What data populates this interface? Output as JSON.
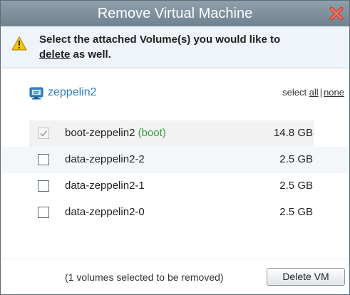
{
  "dialog": {
    "title": "Remove Virtual Machine",
    "close_icon": "close-x-icon",
    "warning_icon": "warning-icon",
    "prompt_line1": "Select the attached Volume(s) you would like to",
    "prompt_line2_underlined": "delete",
    "prompt_line2_rest": " as well."
  },
  "vm": {
    "name": "zeppelin2",
    "icon": "vm-icon"
  },
  "select_links": {
    "prefix": "select ",
    "all": "all",
    "separator": "|",
    "none": "none"
  },
  "background_faint_text": "",
  "volumes": [
    {
      "name": "boot-zeppelin2",
      "tag": "(boot)",
      "size": "14.8 GB",
      "checked": true,
      "disabled": true
    },
    {
      "name": "data-zeppelin2-2",
      "tag": "",
      "size": "2.5 GB",
      "checked": false,
      "disabled": false
    },
    {
      "name": "data-zeppelin2-1",
      "tag": "",
      "size": "2.5 GB",
      "checked": false,
      "disabled": false
    },
    {
      "name": "data-zeppelin2-0",
      "tag": "",
      "size": "2.5 GB",
      "checked": false,
      "disabled": false
    }
  ],
  "footer": {
    "status": "(1 volumes selected to be removed)",
    "delete_button": "Delete VM"
  },
  "colors": {
    "titlebar": "#7a8c99",
    "link_blue": "#2a7cc0",
    "boot_green": "#3a9b3a",
    "close_red": "#e0403a"
  }
}
